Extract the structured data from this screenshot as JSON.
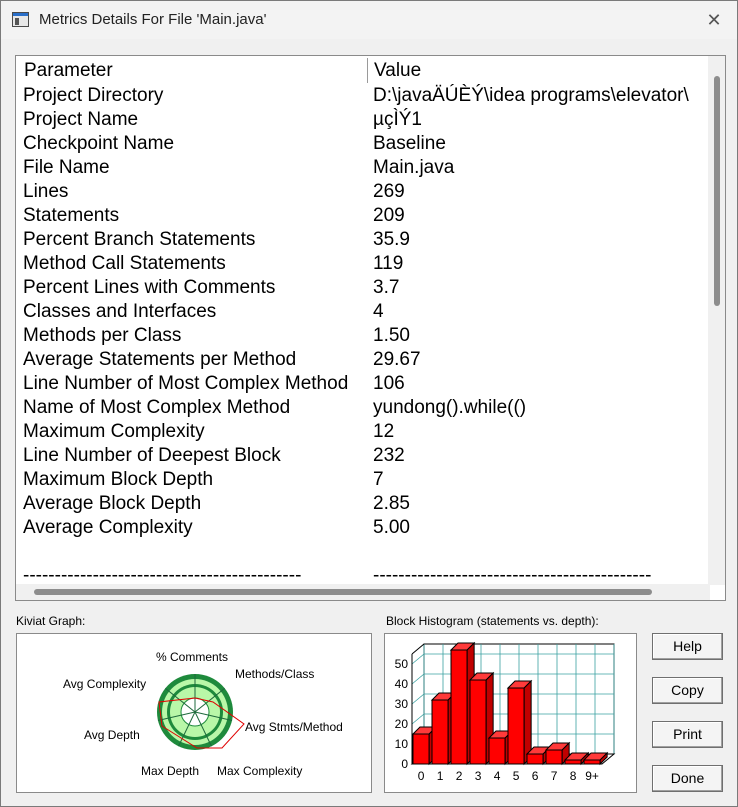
{
  "window": {
    "title": "Metrics Details For File 'Main.java'",
    "close_label": "✕"
  },
  "table": {
    "headers": {
      "parameter": "Parameter",
      "value": "Value"
    },
    "rows": [
      {
        "p": "Project Directory",
        "v": "D:\\javaÄÚÈÝ\\idea  programs\\elevator\\"
      },
      {
        "p": "Project Name",
        "v": "µçÌÝ1"
      },
      {
        "p": "Checkpoint Name",
        "v": "Baseline"
      },
      {
        "p": "File Name",
        "v": "Main.java"
      },
      {
        "p": "Lines",
        "v": "269"
      },
      {
        "p": "Statements",
        "v": "209"
      },
      {
        "p": "Percent Branch Statements",
        "v": "35.9"
      },
      {
        "p": "Method Call Statements",
        "v": "119"
      },
      {
        "p": "Percent Lines with Comments",
        "v": "3.7"
      },
      {
        "p": "Classes and Interfaces",
        "v": "4"
      },
      {
        "p": "Methods per Class",
        "v": "1.50"
      },
      {
        "p": "Average Statements per Method",
        "v": "29.67"
      },
      {
        "p": "Line Number of Most Complex Method",
        "v": "106"
      },
      {
        "p": "Name of Most Complex Method",
        "v": "yundong().while(()"
      },
      {
        "p": "Maximum Complexity",
        "v": "12"
      },
      {
        "p": "Line Number of Deepest Block",
        "v": "232"
      },
      {
        "p": "Maximum Block Depth",
        "v": "7"
      },
      {
        "p": "Average Block Depth",
        "v": "2.85"
      },
      {
        "p": "Average Complexity",
        "v": "5.00"
      },
      {
        "p": "",
        "v": ""
      },
      {
        "p": "--------------------------------------------",
        "v": "--------------------------------------------"
      }
    ]
  },
  "kiviat": {
    "label": "Kiviat Graph:",
    "axes": [
      "% Comments",
      "Methods/Class",
      "Avg Stmts/Method",
      "Max Complexity",
      "Max Depth",
      "Avg Depth",
      "Avg Complexity"
    ]
  },
  "histogram": {
    "label": "Block Histogram (statements vs. depth):",
    "y_ticks": [
      "0",
      "10",
      "20",
      "30",
      "40",
      "50"
    ],
    "categories": [
      "0",
      "1",
      "2",
      "3",
      "4",
      "5",
      "6",
      "7",
      "8",
      "9+"
    ],
    "values": [
      15,
      32,
      57,
      42,
      13,
      38,
      5,
      7,
      2,
      2
    ],
    "ylim": [
      0,
      55
    ],
    "bar_color": "#ff0000"
  },
  "buttons": {
    "help": "Help",
    "copy": "Copy",
    "print": "Print",
    "done": "Done"
  }
}
